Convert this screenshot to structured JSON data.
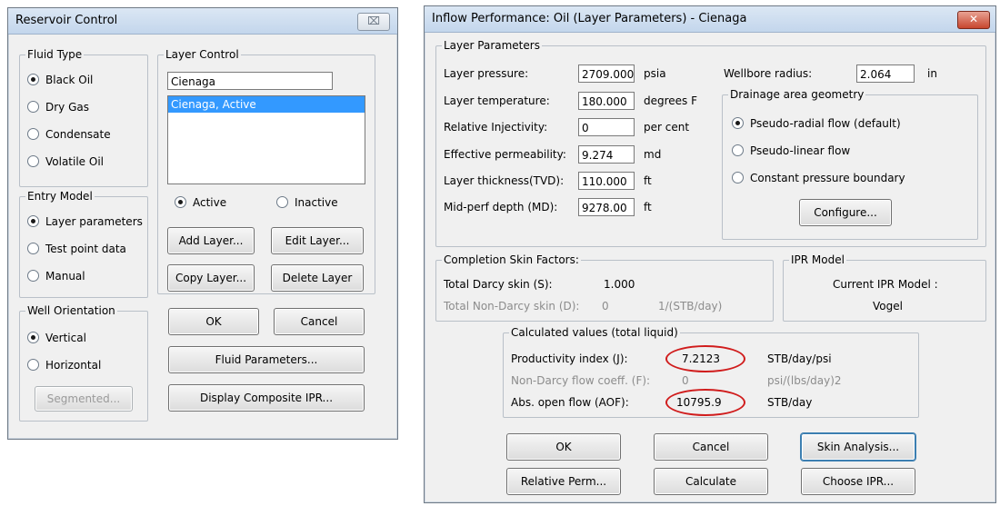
{
  "reservoir": {
    "title": "Reservoir Control",
    "close_glyph": "⌧",
    "fluid_type": {
      "legend": "Fluid Type",
      "options": [
        "Black Oil",
        "Dry Gas",
        "Condensate",
        "Volatile Oil"
      ],
      "selected": "Black Oil"
    },
    "layer_control": {
      "legend": "Layer Control",
      "name_value": "Cienaga",
      "list_items": [
        "Cienaga, Active"
      ],
      "active_label": "Active",
      "inactive_label": "Inactive",
      "add_label": "Add Layer...",
      "edit_label": "Edit Layer...",
      "copy_label": "Copy Layer...",
      "delete_label": "Delete Layer"
    },
    "entry_model": {
      "legend": "Entry Model",
      "options": [
        "Layer parameters",
        "Test point data",
        "Manual"
      ],
      "selected": "Layer parameters"
    },
    "well_orientation": {
      "legend": "Well Orientation",
      "options": [
        "Vertical",
        "Horizontal"
      ],
      "selected": "Vertical",
      "segmented_label": "Segmented..."
    },
    "ok_label": "OK",
    "cancel_label": "Cancel",
    "fluid_params_label": "Fluid Parameters...",
    "composite_label": "Display Composite IPR..."
  },
  "inflow": {
    "title": "Inflow Performance: Oil (Layer Parameters) - Cienaga",
    "close_glyph": "✕",
    "layer_params": {
      "legend": "Layer Parameters",
      "rows": [
        {
          "label": "Layer pressure:",
          "value": "2709.000",
          "unit": "psia"
        },
        {
          "label": "Layer temperature:",
          "value": "180.000",
          "unit": "degrees F"
        },
        {
          "label": "Relative Injectivity:",
          "value": "0",
          "unit": "per cent"
        },
        {
          "label": "Effective permeability:",
          "value": "9.274",
          "unit": "md"
        },
        {
          "label": "Layer thickness(TVD):",
          "value": "110.000",
          "unit": "ft"
        },
        {
          "label": "Mid-perf depth (MD):",
          "value": "9278.00",
          "unit": "ft"
        }
      ],
      "wellbore_label": "Wellbore radius:",
      "wellbore_value": "2.064",
      "wellbore_unit": "in"
    },
    "drainage": {
      "legend": "Drainage area geometry",
      "options": [
        "Pseudo-radial flow (default)",
        "Pseudo-linear flow",
        "Constant pressure boundary"
      ],
      "selected": "Pseudo-radial flow (default)",
      "configure_label": "Configure..."
    },
    "skin": {
      "legend": "Completion Skin Factors:",
      "darcy_label": "Total Darcy skin (S):",
      "darcy_value": "1.000",
      "nondarcy_label": "Total Non-Darcy skin (D):",
      "nondarcy_value": "0",
      "nondarcy_unit": "1/(STB/day)"
    },
    "ipr_model": {
      "legend": "IPR Model",
      "current_label": "Current IPR Model :",
      "current_value": "Vogel"
    },
    "calc": {
      "legend": "Calculated values (total liquid)",
      "pi_label": "Productivity index (J):",
      "pi_value": "7.2123",
      "pi_unit": "STB/day/psi",
      "ndf_label": "Non-Darcy flow coeff. (F):",
      "ndf_value": "0",
      "ndf_unit": "psi/(lbs/day)2",
      "aof_label": "Abs. open flow (AOF):",
      "aof_value": "10795.9",
      "aof_unit": "STB/day"
    },
    "ok_label": "OK",
    "cancel_label": "Cancel",
    "skin_analysis_label": "Skin Analysis...",
    "relperm_label": "Relative Perm...",
    "calculate_label": "Calculate",
    "choose_ipr_label": "Choose IPR..."
  },
  "colors": {
    "dialog_bg": "#f0f0f0",
    "list_selection": "#3399ff",
    "highlight_ellipse": "#d01c1c",
    "close_red": "#c8462e"
  }
}
